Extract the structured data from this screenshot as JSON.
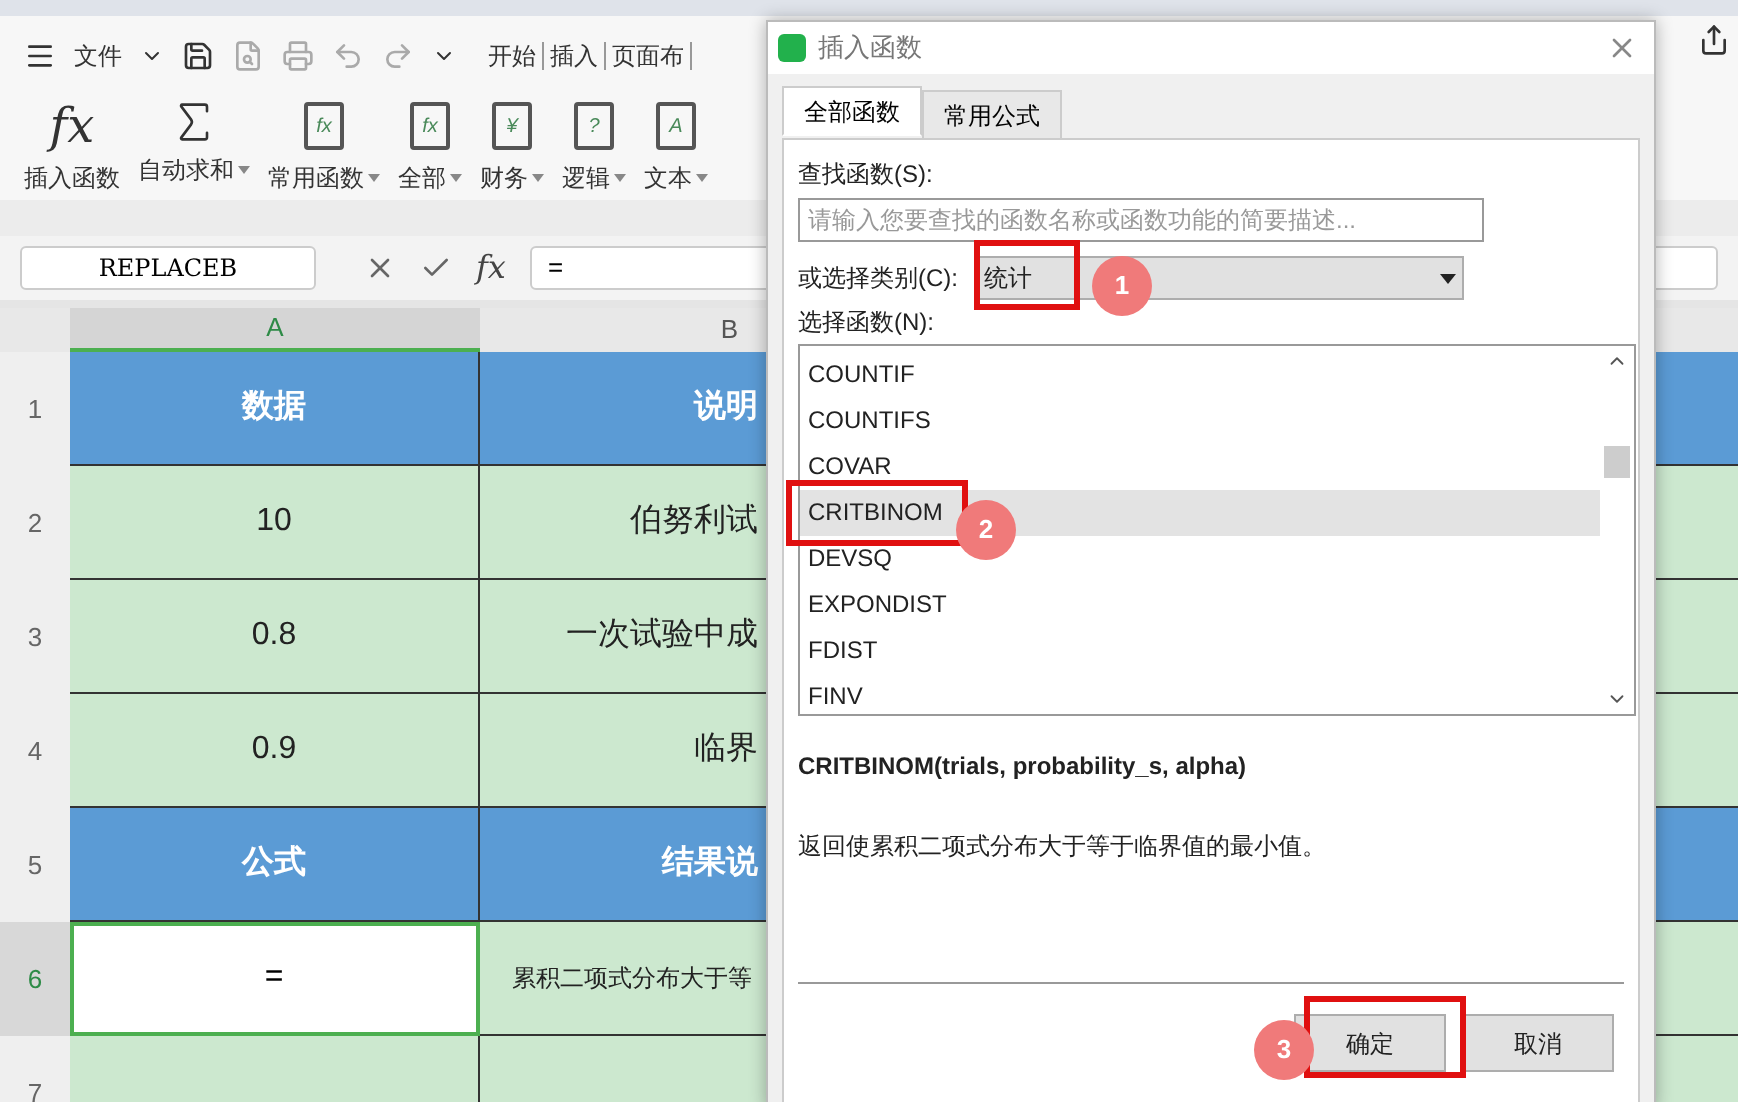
{
  "toolbar": {
    "menu": "文件",
    "tabs": [
      "开始",
      "插入",
      "页面布"
    ]
  },
  "ribbon": [
    {
      "kind": "fx",
      "glyph": "fx",
      "label": "插入函数",
      "dropdown": false
    },
    {
      "kind": "sigma",
      "label": "自动求和",
      "dropdown": true
    },
    {
      "kind": "book",
      "glyph": "fx",
      "label": "常用函数",
      "dropdown": true
    },
    {
      "kind": "book",
      "glyph": "fx",
      "label": "全部",
      "dropdown": true
    },
    {
      "kind": "book",
      "glyph": "¥",
      "label": "财务",
      "dropdown": true
    },
    {
      "kind": "book",
      "glyph": "?",
      "label": "逻辑",
      "dropdown": true
    },
    {
      "kind": "book",
      "glyph": "A",
      "label": "文本",
      "dropdown": true
    }
  ],
  "formula_bar": {
    "name_box": "REPLACEB",
    "fx": "fx",
    "value": "="
  },
  "sheet": {
    "columns": [
      {
        "label": "A",
        "selected": true
      },
      {
        "label": "B",
        "selected": false
      }
    ],
    "rows": [
      {
        "label": "1",
        "selected": false,
        "kind": "header",
        "cells": [
          "数据",
          "说明"
        ]
      },
      {
        "label": "2",
        "selected": false,
        "kind": "data",
        "cells": [
          "10",
          "伯努利试"
        ]
      },
      {
        "label": "3",
        "selected": false,
        "kind": "data",
        "cells": [
          "0.8",
          "一次试验中成"
        ]
      },
      {
        "label": "4",
        "selected": false,
        "kind": "data",
        "cells": [
          "0.9",
          "临界"
        ]
      },
      {
        "label": "5",
        "selected": false,
        "kind": "header",
        "cells": [
          "公式",
          "结果说"
        ]
      },
      {
        "label": "6",
        "selected": true,
        "kind": "note",
        "cells": [
          "=",
          "累积二项式分布大于等"
        ]
      },
      {
        "label": "7",
        "selected": false,
        "kind": "data",
        "cells": [
          "",
          ""
        ]
      }
    ]
  },
  "dialog": {
    "title": "插入函数",
    "tabs": [
      {
        "label": "全部函数",
        "selected": true
      },
      {
        "label": "常用公式",
        "selected": false
      }
    ],
    "search_label": "查找函数(S):",
    "search": {
      "placeholder": "请输入您要查找的函数名称或函数功能的简要描述..."
    },
    "category_label": "或选择类别(C):",
    "category": "统计",
    "list_label": "选择函数(N):",
    "functions": [
      {
        "name": "COUNTIF",
        "selected": false
      },
      {
        "name": "COUNTIFS",
        "selected": false
      },
      {
        "name": "COVAR",
        "selected": false
      },
      {
        "name": "CRITBINOM",
        "selected": true
      },
      {
        "name": "DEVSQ",
        "selected": false
      },
      {
        "name": "EXPONDIST",
        "selected": false
      },
      {
        "name": "FDIST",
        "selected": false
      },
      {
        "name": "FINV",
        "selected": false
      }
    ],
    "signature": "CRITBINOM(trials, probability_s, alpha)",
    "description": "返回使累积二项式分布大于等于临界值的最小值。",
    "buttons": [
      "确定",
      "取消"
    ]
  },
  "steps": [
    "1",
    "2",
    "3"
  ]
}
